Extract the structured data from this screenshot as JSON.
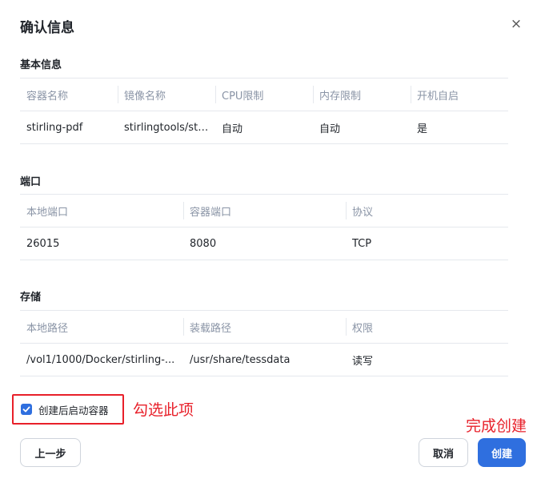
{
  "dialog": {
    "title": "确认信息",
    "close_icon": "×"
  },
  "basic": {
    "label": "基本信息",
    "headers": [
      "容器名称",
      "镜像名称",
      "CPU限制",
      "内存限制",
      "开机自启"
    ],
    "row": [
      "stirling-pdf",
      "stirlingtools/sti...",
      "自动",
      "自动",
      "是"
    ]
  },
  "ports": {
    "label": "端口",
    "headers": [
      "本地端口",
      "容器端口",
      "协议"
    ],
    "row": [
      "26015",
      "8080",
      "TCP"
    ]
  },
  "storage": {
    "label": "存储",
    "headers": [
      "本地路径",
      "装载路径",
      "权限"
    ],
    "row": [
      "/vol1/1000/Docker/stirling-...",
      "/usr/share/tessdata",
      "读写"
    ]
  },
  "autostart": {
    "label": "创建后启动容器",
    "checked": true,
    "annotation": "勾选此项"
  },
  "footer": {
    "prev_label": "上一步",
    "cancel_label": "取消",
    "create_label": "创建",
    "annotation": "完成创建"
  },
  "colors": {
    "accent": "#2f6fdf",
    "annotation_red": "#e8202a"
  }
}
